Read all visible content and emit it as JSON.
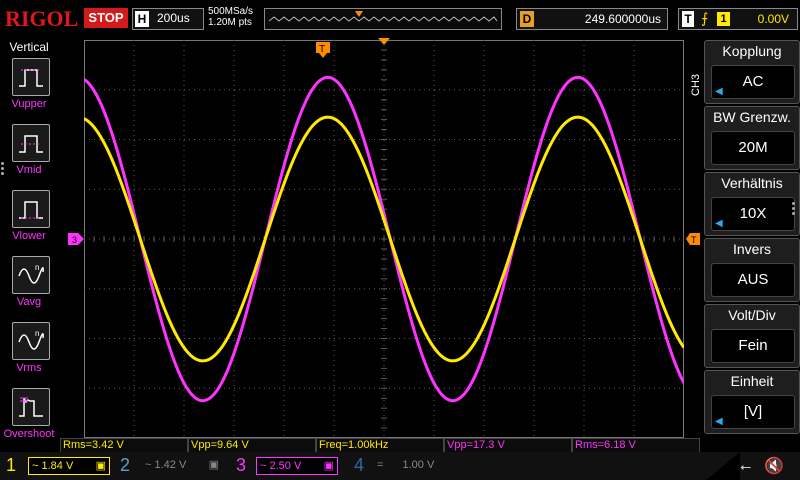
{
  "top": {
    "logo": "RIGOL",
    "run_state": "STOP",
    "timebase_tag": "H",
    "timebase": "200us",
    "sample_rate": "500MSa/s",
    "memory_depth": "1.20M pts",
    "delay_tag": "D",
    "delay": "249.600000us",
    "trigger_tag": "T",
    "trigger_edge": "⨍",
    "trigger_source": "1",
    "trigger_level": "0.00V"
  },
  "left_menu": {
    "title": "Vertical",
    "items": [
      {
        "label": "Vupper",
        "icon": "vupper-icon"
      },
      {
        "label": "Vmid",
        "icon": "vmid-icon"
      },
      {
        "label": "Vlower",
        "icon": "vlower-icon"
      },
      {
        "label": "Vavg",
        "icon": "vavg-icon"
      },
      {
        "label": "Vrms",
        "icon": "vrms-icon"
      },
      {
        "label": "Overshoot",
        "icon": "overshoot-icon"
      }
    ]
  },
  "right_menu": {
    "channel_label": "CH3",
    "items": [
      {
        "title": "Kopplung",
        "value": "AC",
        "arrow": true
      },
      {
        "title": "BW Grenzw.",
        "value": "20M",
        "arrow": false
      },
      {
        "title": "Verhältnis",
        "value": "10X",
        "arrow": true
      },
      {
        "title": "Invers",
        "value": "AUS",
        "arrow": false
      },
      {
        "title": "Volt/Div",
        "value": "Fein",
        "arrow": false
      },
      {
        "title": "Einheit",
        "value": "[V]",
        "arrow": true
      }
    ]
  },
  "measurements": [
    {
      "text": "Rms=3.42 V",
      "color": "yellow"
    },
    {
      "text": "Vpp=9.64 V",
      "color": "yellow"
    },
    {
      "text": "Freq=1.00kHz",
      "color": "yellow"
    },
    {
      "text": "Vpp=17.3 V",
      "color": "magenta"
    },
    {
      "text": "Rms=6.18 V",
      "color": "magenta"
    }
  ],
  "channels": [
    {
      "num": "1",
      "scale": "1.84 V",
      "coupling": "~",
      "active": true
    },
    {
      "num": "2",
      "scale": "1.42 V",
      "coupling": "~",
      "active": false
    },
    {
      "num": "3",
      "scale": "2.50 V",
      "coupling": "~",
      "active": true
    },
    {
      "num": "4",
      "scale": "1.00 V",
      "coupling": "=",
      "active": false
    }
  ],
  "markers": {
    "ch3_left": "3",
    "trigger_top": "T"
  },
  "colors": {
    "ch1": "#ffea00",
    "ch3": "#ff33ff",
    "grid": "#5a5a5a",
    "trigger": "#ff8c00",
    "stop": "#d21a1a"
  },
  "waveform": {
    "ch1_amplitude_div": 2.45,
    "ch3_amplitude_div": 3.25,
    "periods_on_screen": 2.4,
    "frequency": "1.00kHz"
  }
}
